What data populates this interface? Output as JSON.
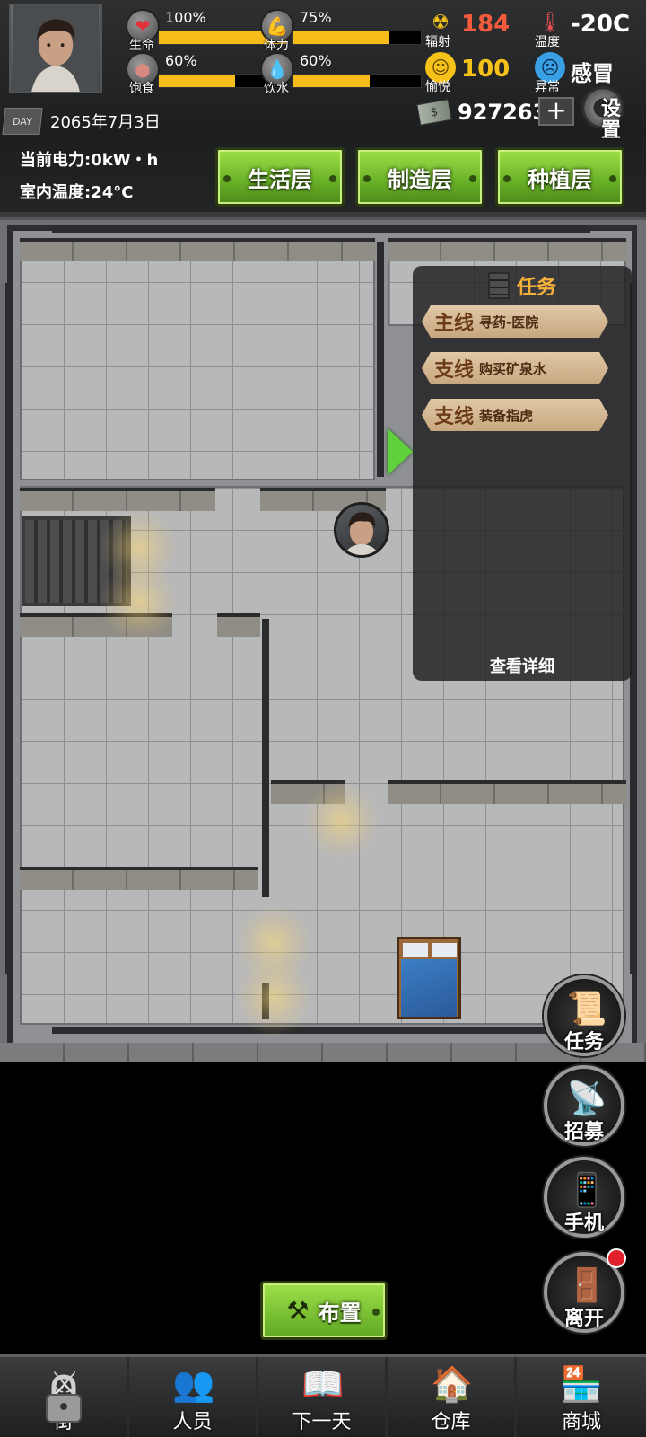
{
  "hud": {
    "stats": [
      {
        "label": "生命",
        "value": "100%",
        "fill": 1.0,
        "icon": "heart-icon",
        "color": "#e0323c"
      },
      {
        "label": "体力",
        "value": "75%",
        "fill": 0.75,
        "icon": "muscle-icon",
        "color": "#e0723c"
      },
      {
        "label": "饱食",
        "value": "60%",
        "fill": 0.6,
        "icon": "stomach-icon",
        "color": "#d88a80"
      },
      {
        "label": "饮水",
        "value": "60%",
        "fill": 0.6,
        "icon": "water-drop-icon",
        "color": "#5aa8e6"
      }
    ],
    "radiation": {
      "label": "辐射",
      "value": "184",
      "color": "#f45a3c",
      "icon": "radiation-icon"
    },
    "joy": {
      "label": "愉悦",
      "value": "100",
      "color": "#f6c21a",
      "icon": "smiley-icon"
    },
    "temperature": {
      "label": "温度",
      "value": "-20C",
      "icon": "thermometer-icon"
    },
    "abnormal": {
      "label": "异常",
      "value": "感冒",
      "icon": "sad-face-icon"
    },
    "date": "2065年7月3日",
    "calendar_icon_text": "DAY",
    "money": "927263",
    "plus": "+",
    "settings": "设置",
    "power": "当前电力:0kW・h",
    "indoor_temp": "室内温度:24°C",
    "floors": [
      "生活层",
      "制造层",
      "种植层"
    ]
  },
  "quest_panel": {
    "title": "任务",
    "items": [
      {
        "type": "主线",
        "name": "寻药-医院"
      },
      {
        "type": "支线",
        "name": "购买矿泉水"
      },
      {
        "type": "支线",
        "name": "装备指虎"
      }
    ],
    "detail": "查看详细"
  },
  "side_buttons": [
    {
      "label": "任务",
      "icon": "scroll-icon"
    },
    {
      "label": "招募",
      "icon": "satellite-dish-icon"
    },
    {
      "label": "手机",
      "icon": "phone-icon"
    },
    {
      "label": "离开",
      "icon": "exit-door-icon",
      "badge": true
    }
  ],
  "arrange": {
    "label": "布置",
    "icon": "tools-icon"
  },
  "nav": [
    {
      "label": "街",
      "icon": "crossed-swords-icon",
      "locked": true
    },
    {
      "label": "人员",
      "icon": "people-icon"
    },
    {
      "label": "下一天",
      "icon": "book-icon"
    },
    {
      "label": "仓库",
      "icon": "warehouse-icon"
    },
    {
      "label": "商城",
      "icon": "shop-icon"
    }
  ]
}
